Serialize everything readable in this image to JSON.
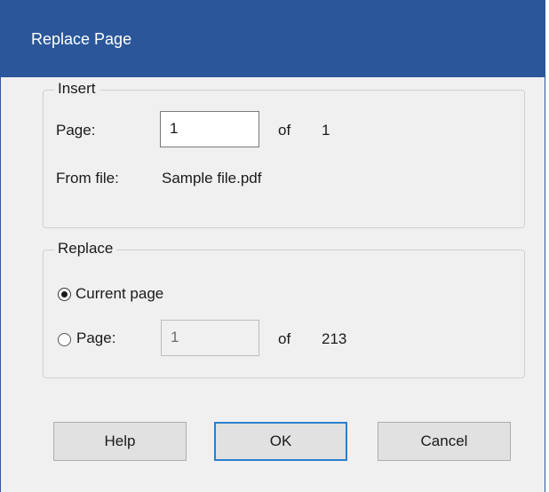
{
  "dialog": {
    "title": "Replace Page",
    "accent_color": "#2b579a"
  },
  "insert_group": {
    "legend": "Insert",
    "page_label": "Page:",
    "page_value": "1",
    "of_label": "of",
    "page_total": "1",
    "from_file_label": "From file:",
    "from_file_value": "Sample file.pdf"
  },
  "replace_group": {
    "legend": "Replace",
    "current_page_label": "Current page",
    "current_page_selected": true,
    "page_option_label": "Page:",
    "page_option_selected": false,
    "page_value": "1",
    "of_label": "of",
    "page_total": "213"
  },
  "buttons": {
    "help": "Help",
    "ok": "OK",
    "cancel": "Cancel"
  }
}
